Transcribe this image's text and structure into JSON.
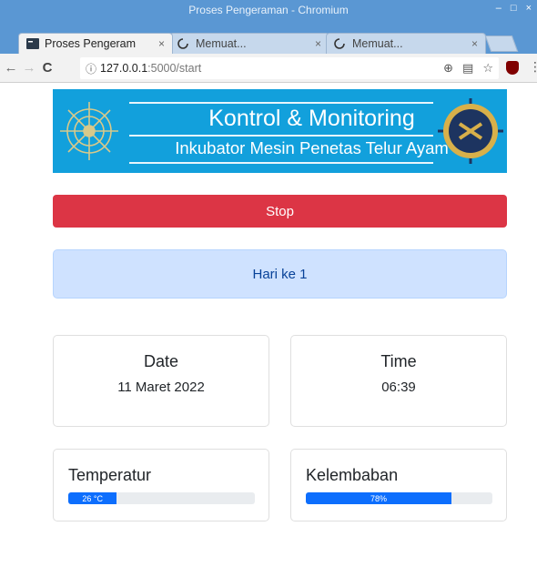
{
  "window": {
    "title": "Proses Pengeraman - Chromium"
  },
  "tabs": [
    {
      "label": "Proses Pengeram",
      "active": true,
      "favicon": "terminal-icon"
    },
    {
      "label": "Memuat...",
      "active": false,
      "favicon": "loading-icon"
    },
    {
      "label": "Memuat...",
      "active": false,
      "favicon": "loading-icon"
    }
  ],
  "address": {
    "host": "127.0.0.1",
    "path": ":5000/start"
  },
  "banner": {
    "line1": "Kontrol & Monitoring",
    "line2": "Inkubator Mesin Penetas Telur Ayam"
  },
  "controls": {
    "stop_label": "Stop"
  },
  "status": {
    "day_text": "Hari ke 1"
  },
  "date_card": {
    "heading": "Date",
    "value": "11 Maret 2022"
  },
  "time_card": {
    "heading": "Time",
    "value": "06:39"
  },
  "temperature": {
    "title": "Temperatur",
    "label": "26 °C",
    "percent": 26
  },
  "humidity": {
    "title": "Kelembaban",
    "label": "78%",
    "percent": 78
  },
  "colors": {
    "accent": "#0d6efd",
    "danger": "#dc3545",
    "banner": "#12a0dc",
    "chrome": "#5a97d3"
  }
}
